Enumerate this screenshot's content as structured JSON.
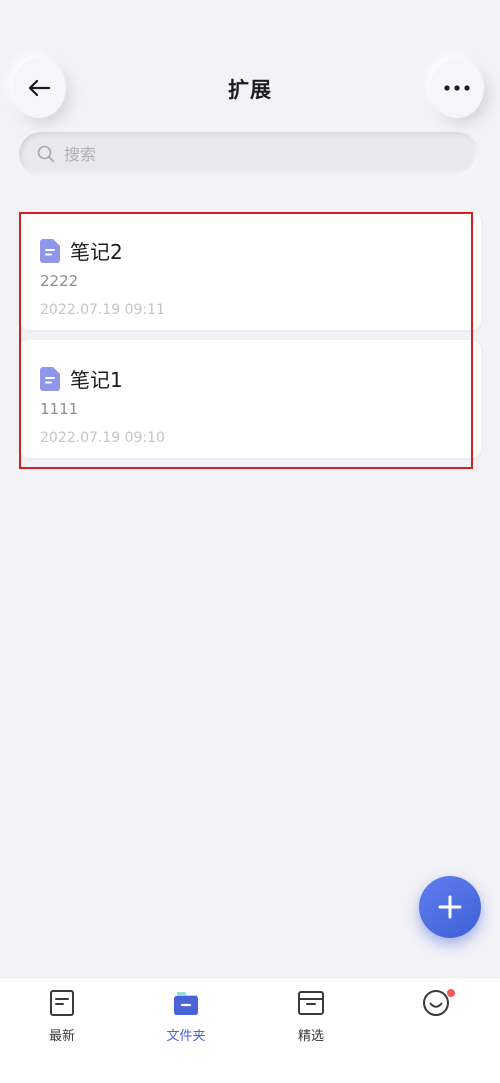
{
  "header": {
    "title": "扩展",
    "back_icon": "arrow-left-icon",
    "more_icon": "more-horizontal-icon"
  },
  "search": {
    "placeholder": "搜索",
    "icon": "search-icon"
  },
  "notes": [
    {
      "title": "笔记2",
      "body": "2222",
      "date": "2022.07.19 09:11"
    },
    {
      "title": "笔记1",
      "body": "1111",
      "date": "2022.07.19 09:10"
    }
  ],
  "fab": {
    "icon": "plus-icon",
    "color": "#4a68e0"
  },
  "tabbar": {
    "tabs": [
      {
        "label": "最新",
        "icon": "recent-doc-icon",
        "active": false
      },
      {
        "label": "文件夹",
        "icon": "folder-icon",
        "active": true
      },
      {
        "label": "精选",
        "icon": "archive-box-icon",
        "active": false
      },
      {
        "label": "",
        "icon": "smile-face-icon",
        "active": false,
        "badge": true
      }
    ]
  },
  "colors": {
    "accent": "#4a63d8",
    "note_icon": "#8f97ea",
    "highlight": "#d62020",
    "badge": "#ef5a5a"
  }
}
